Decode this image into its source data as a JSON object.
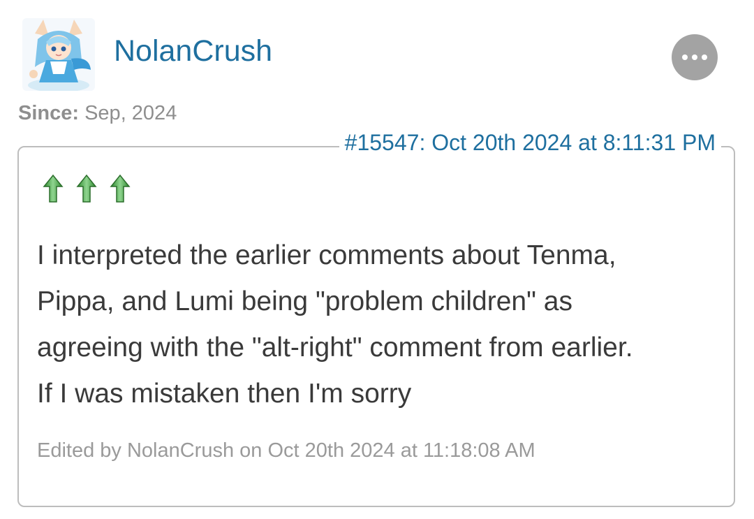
{
  "user": {
    "name": "NolanCrush",
    "avatar_icon": "anime-character-avatar-icon",
    "since_label": "Since:",
    "since_value": " Sep, 2024"
  },
  "actions": {
    "more_icon": "ellipsis-icon"
  },
  "post": {
    "meta": "#15547: Oct 20th 2024 at 8:11:31 PM",
    "arrow_icon": "green-up-arrow-icon",
    "arrow_count": 3,
    "body_lines": [
      "I interpreted the earlier comments about Tenma,",
      "Pippa, and Lumi being \"problem children\" as",
      "agreeing with the \"alt-right\" comment from earlier.",
      "If I was mistaken then I'm sorry"
    ],
    "edited": "Edited by NolanCrush on Oct 20th 2024 at 11:18:08 AM"
  },
  "colors": {
    "link": "#1e6f9f",
    "arrow": "#4aa34a",
    "border": "#bdbdbd",
    "more_button": "#a3a3a3"
  }
}
